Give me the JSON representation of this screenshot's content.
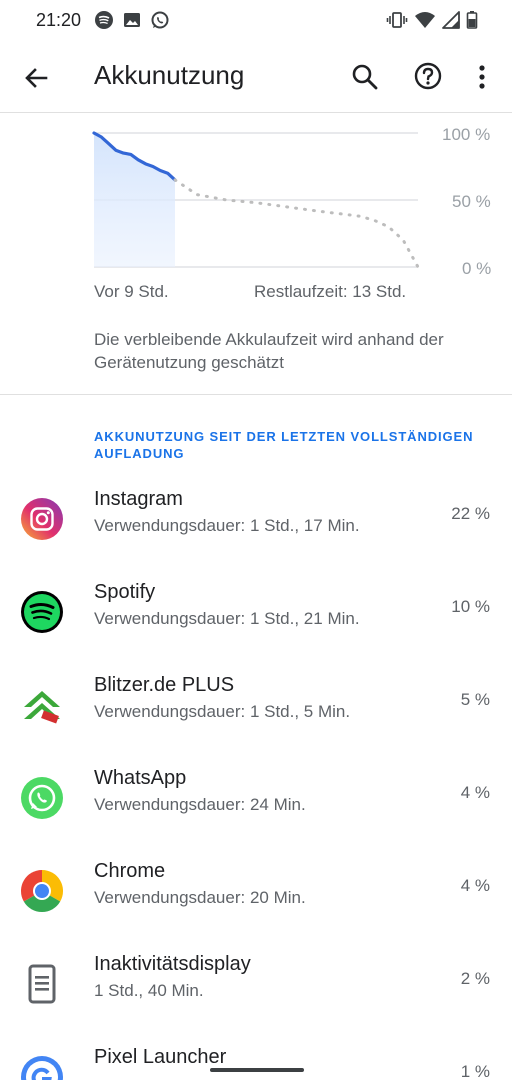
{
  "status_bar": {
    "time": "21:20",
    "left_icons": [
      "spotify-icon",
      "image-icon",
      "whatsapp-icon"
    ],
    "right_icons": [
      "vibrate-icon",
      "wifi-icon",
      "signal-icon",
      "battery-icon"
    ]
  },
  "app_bar": {
    "title": "Akkunutzung",
    "actions": [
      "search-icon",
      "help-icon",
      "more-vert-icon"
    ]
  },
  "chart_data": {
    "type": "line",
    "y_ticks": [
      "100 %",
      "50 %",
      "0 %"
    ],
    "ylim": [
      0,
      100
    ],
    "x_label_start": "Vor 9 Std.",
    "x_label_end": "Restlaufzeit: 13 Std.",
    "grid": true,
    "series": [
      {
        "x": [
          0,
          0.5,
          1,
          1.5,
          2,
          2.5,
          3,
          3.5,
          4,
          4.5,
          5,
          5.5
        ],
        "values": [
          100,
          97,
          92,
          87,
          85,
          84,
          80,
          77,
          75,
          72,
          70,
          65
        ],
        "line_style": "solid",
        "color": "#3367d6"
      },
      {
        "x": [
          5.5,
          7,
          9,
          11,
          13,
          15,
          16.5,
          18,
          19,
          20,
          21,
          22
        ],
        "values": [
          65,
          54,
          50,
          48,
          45,
          42,
          40,
          38,
          35,
          30,
          20,
          0
        ],
        "line_style": "dotted",
        "color": "#bdbdbd"
      }
    ]
  },
  "estimate_note": "Die verbleibende Akkulaufzeit wird anhand der Gerätenutzung geschätzt",
  "section_header": "AKKUNUTZUNG SEIT DER LETZTEN VOLLSTÄNDIGEN AUFLADUNG",
  "apps": [
    {
      "name": "Instagram",
      "usage": "Verwendungsdauer: 1 Std., 17 Min.",
      "percent": "22 %",
      "icon": "instagram-icon"
    },
    {
      "name": "Spotify",
      "usage": "Verwendungsdauer: 1 Std., 21 Min.",
      "percent": "10 %",
      "icon": "spotify-icon"
    },
    {
      "name": "Blitzer.de PLUS",
      "usage": "Verwendungsdauer: 1 Std., 5 Min.",
      "percent": "5 %",
      "icon": "blitzer-icon"
    },
    {
      "name": "WhatsApp",
      "usage": "Verwendungsdauer: 24 Min.",
      "percent": "4 %",
      "icon": "whatsapp-icon"
    },
    {
      "name": "Chrome",
      "usage": "Verwendungsdauer: 20 Min.",
      "percent": "4 %",
      "icon": "chrome-icon"
    },
    {
      "name": "Inaktivitätsdisplay",
      "usage": "1 Std., 40 Min.",
      "percent": "2 %",
      "icon": "display-icon"
    },
    {
      "name": "Pixel Launcher",
      "usage": "",
      "percent": "1 %",
      "icon": "pixel-launcher-icon"
    }
  ]
}
